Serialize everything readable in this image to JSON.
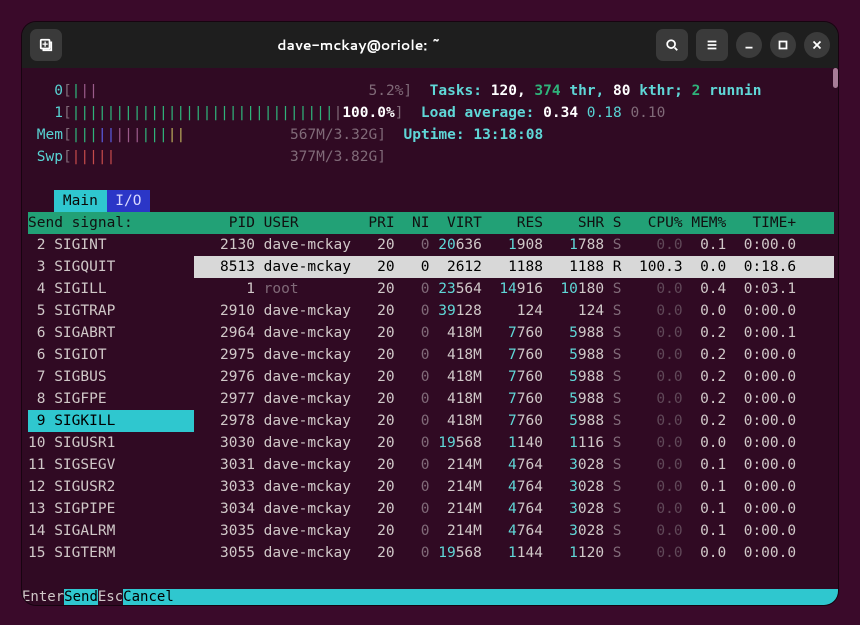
{
  "window": {
    "title": "dave-mckay@oriole: ~"
  },
  "meters": {
    "cpu0": {
      "label": "0",
      "pct": "5.2%"
    },
    "cpu1": {
      "label": "1",
      "pct": "100.0%"
    },
    "mem": {
      "label": "Mem",
      "used": "567M",
      "total": "3.32G"
    },
    "swp": {
      "label": "Swp",
      "used": "377M",
      "total": "3.82G"
    },
    "tasks": {
      "label": "Tasks:",
      "total": "120",
      "thr": "374",
      "kthr": "80",
      "running": "2"
    },
    "load": {
      "label": "Load average:",
      "l1": "0.34",
      "l5": "0.18",
      "l15": "0.10"
    },
    "uptime": {
      "label": "Uptime:",
      "val": "13:18:08"
    }
  },
  "tabs": {
    "main": "Main",
    "io": "I/O"
  },
  "signal_panel": {
    "title": "Send signal:"
  },
  "signals": [
    {
      "n": "2",
      "name": "SIGINT"
    },
    {
      "n": "3",
      "name": "SIGQUIT"
    },
    {
      "n": "4",
      "name": "SIGILL"
    },
    {
      "n": "5",
      "name": "SIGTRAP"
    },
    {
      "n": "6",
      "name": "SIGABRT"
    },
    {
      "n": "6",
      "name": "SIGIOT"
    },
    {
      "n": "7",
      "name": "SIGBUS"
    },
    {
      "n": "8",
      "name": "SIGFPE"
    },
    {
      "n": "9",
      "name": "SIGKILL"
    },
    {
      "n": "10",
      "name": "SIGUSR1"
    },
    {
      "n": "11",
      "name": "SIGSEGV"
    },
    {
      "n": "12",
      "name": "SIGUSR2"
    },
    {
      "n": "13",
      "name": "SIGPIPE"
    },
    {
      "n": "14",
      "name": "SIGALRM"
    },
    {
      "n": "15",
      "name": "SIGTERM"
    }
  ],
  "signal_selected": 8,
  "headers": {
    "pid": "PID",
    "user": "USER",
    "pri": "PRI",
    "ni": "NI",
    "virt": "VIRT",
    "res": "RES",
    "shr": "SHR",
    "s": "S",
    "cpu": "CPU%",
    "mem": "MEM%",
    "time": "TIME+"
  },
  "processes": [
    {
      "pid": "2130",
      "user": "dave-mckay",
      "pri": "20",
      "ni": "0",
      "virt_a": "20",
      "virt_b": "636",
      "res_a": "1",
      "res_b": "908",
      "shr_a": "1",
      "shr_b": "788",
      "s": "S",
      "cpu": "0.0",
      "mem": "0.1",
      "time": "0:00.0"
    },
    {
      "pid": "8513",
      "user": "dave-mckay",
      "pri": "20",
      "ni": "0",
      "virt_a": "",
      "virt_b": "2612",
      "res_a": "",
      "res_b": "1188",
      "shr_a": "",
      "shr_b": "1188",
      "s": "R",
      "cpu": "100.3",
      "mem": "0.0",
      "time": "0:18.6",
      "selected": true
    },
    {
      "pid": "1",
      "user": "root",
      "pri": "20",
      "ni": "0",
      "virt_a": "23",
      "virt_b": "564",
      "res_a": "14",
      "res_b": "916",
      "shr_a": "10",
      "shr_b": "180",
      "s": "S",
      "cpu": "0.0",
      "mem": "0.4",
      "time": "0:03.1",
      "root": true
    },
    {
      "pid": "2910",
      "user": "dave-mckay",
      "pri": "20",
      "ni": "0",
      "virt_a": "39",
      "virt_b": "128",
      "res_a": "",
      "res_b": "124",
      "shr_a": "",
      "shr_b": "124",
      "s": "S",
      "cpu": "0.0",
      "mem": "0.0",
      "time": "0:00.0"
    },
    {
      "pid": "2964",
      "user": "dave-mckay",
      "pri": "20",
      "ni": "0",
      "virt_a": "",
      "virt_b": "418M",
      "res_a": "7",
      "res_b": "760",
      "shr_a": "5",
      "shr_b": "988",
      "s": "S",
      "cpu": "0.0",
      "mem": "0.2",
      "time": "0:00.1"
    },
    {
      "pid": "2975",
      "user": "dave-mckay",
      "pri": "20",
      "ni": "0",
      "virt_a": "",
      "virt_b": "418M",
      "res_a": "7",
      "res_b": "760",
      "shr_a": "5",
      "shr_b": "988",
      "s": "S",
      "cpu": "0.0",
      "mem": "0.2",
      "time": "0:00.0"
    },
    {
      "pid": "2976",
      "user": "dave-mckay",
      "pri": "20",
      "ni": "0",
      "virt_a": "",
      "virt_b": "418M",
      "res_a": "7",
      "res_b": "760",
      "shr_a": "5",
      "shr_b": "988",
      "s": "S",
      "cpu": "0.0",
      "mem": "0.2",
      "time": "0:00.0"
    },
    {
      "pid": "2977",
      "user": "dave-mckay",
      "pri": "20",
      "ni": "0",
      "virt_a": "",
      "virt_b": "418M",
      "res_a": "7",
      "res_b": "760",
      "shr_a": "5",
      "shr_b": "988",
      "s": "S",
      "cpu": "0.0",
      "mem": "0.2",
      "time": "0:00.0"
    },
    {
      "pid": "2978",
      "user": "dave-mckay",
      "pri": "20",
      "ni": "0",
      "virt_a": "",
      "virt_b": "418M",
      "res_a": "7",
      "res_b": "760",
      "shr_a": "5",
      "shr_b": "988",
      "s": "S",
      "cpu": "0.0",
      "mem": "0.2",
      "time": "0:00.0"
    },
    {
      "pid": "3030",
      "user": "dave-mckay",
      "pri": "20",
      "ni": "0",
      "virt_a": "19",
      "virt_b": "568",
      "res_a": "1",
      "res_b": "140",
      "shr_a": "1",
      "shr_b": "116",
      "s": "S",
      "cpu": "0.0",
      "mem": "0.0",
      "time": "0:00.0"
    },
    {
      "pid": "3031",
      "user": "dave-mckay",
      "pri": "20",
      "ni": "0",
      "virt_a": "",
      "virt_b": "214M",
      "res_a": "4",
      "res_b": "764",
      "shr_a": "3",
      "shr_b": "028",
      "s": "S",
      "cpu": "0.0",
      "mem": "0.1",
      "time": "0:00.0"
    },
    {
      "pid": "3033",
      "user": "dave-mckay",
      "pri": "20",
      "ni": "0",
      "virt_a": "",
      "virt_b": "214M",
      "res_a": "4",
      "res_b": "764",
      "shr_a": "3",
      "shr_b": "028",
      "s": "S",
      "cpu": "0.0",
      "mem": "0.1",
      "time": "0:00.0"
    },
    {
      "pid": "3034",
      "user": "dave-mckay",
      "pri": "20",
      "ni": "0",
      "virt_a": "",
      "virt_b": "214M",
      "res_a": "4",
      "res_b": "764",
      "shr_a": "3",
      "shr_b": "028",
      "s": "S",
      "cpu": "0.0",
      "mem": "0.1",
      "time": "0:00.0"
    },
    {
      "pid": "3035",
      "user": "dave-mckay",
      "pri": "20",
      "ni": "0",
      "virt_a": "",
      "virt_b": "214M",
      "res_a": "4",
      "res_b": "764",
      "shr_a": "3",
      "shr_b": "028",
      "s": "S",
      "cpu": "0.0",
      "mem": "0.1",
      "time": "0:00.0"
    },
    {
      "pid": "3055",
      "user": "dave-mckay",
      "pri": "20",
      "ni": "0",
      "virt_a": "19",
      "virt_b": "568",
      "res_a": "1",
      "res_b": "144",
      "shr_a": "1",
      "shr_b": "120",
      "s": "S",
      "cpu": "0.0",
      "mem": "0.0",
      "time": "0:00.0"
    }
  ],
  "footer": {
    "enter": "Enter",
    "send": "Send   ",
    "esc": "Esc",
    "cancel": "Cancel"
  }
}
